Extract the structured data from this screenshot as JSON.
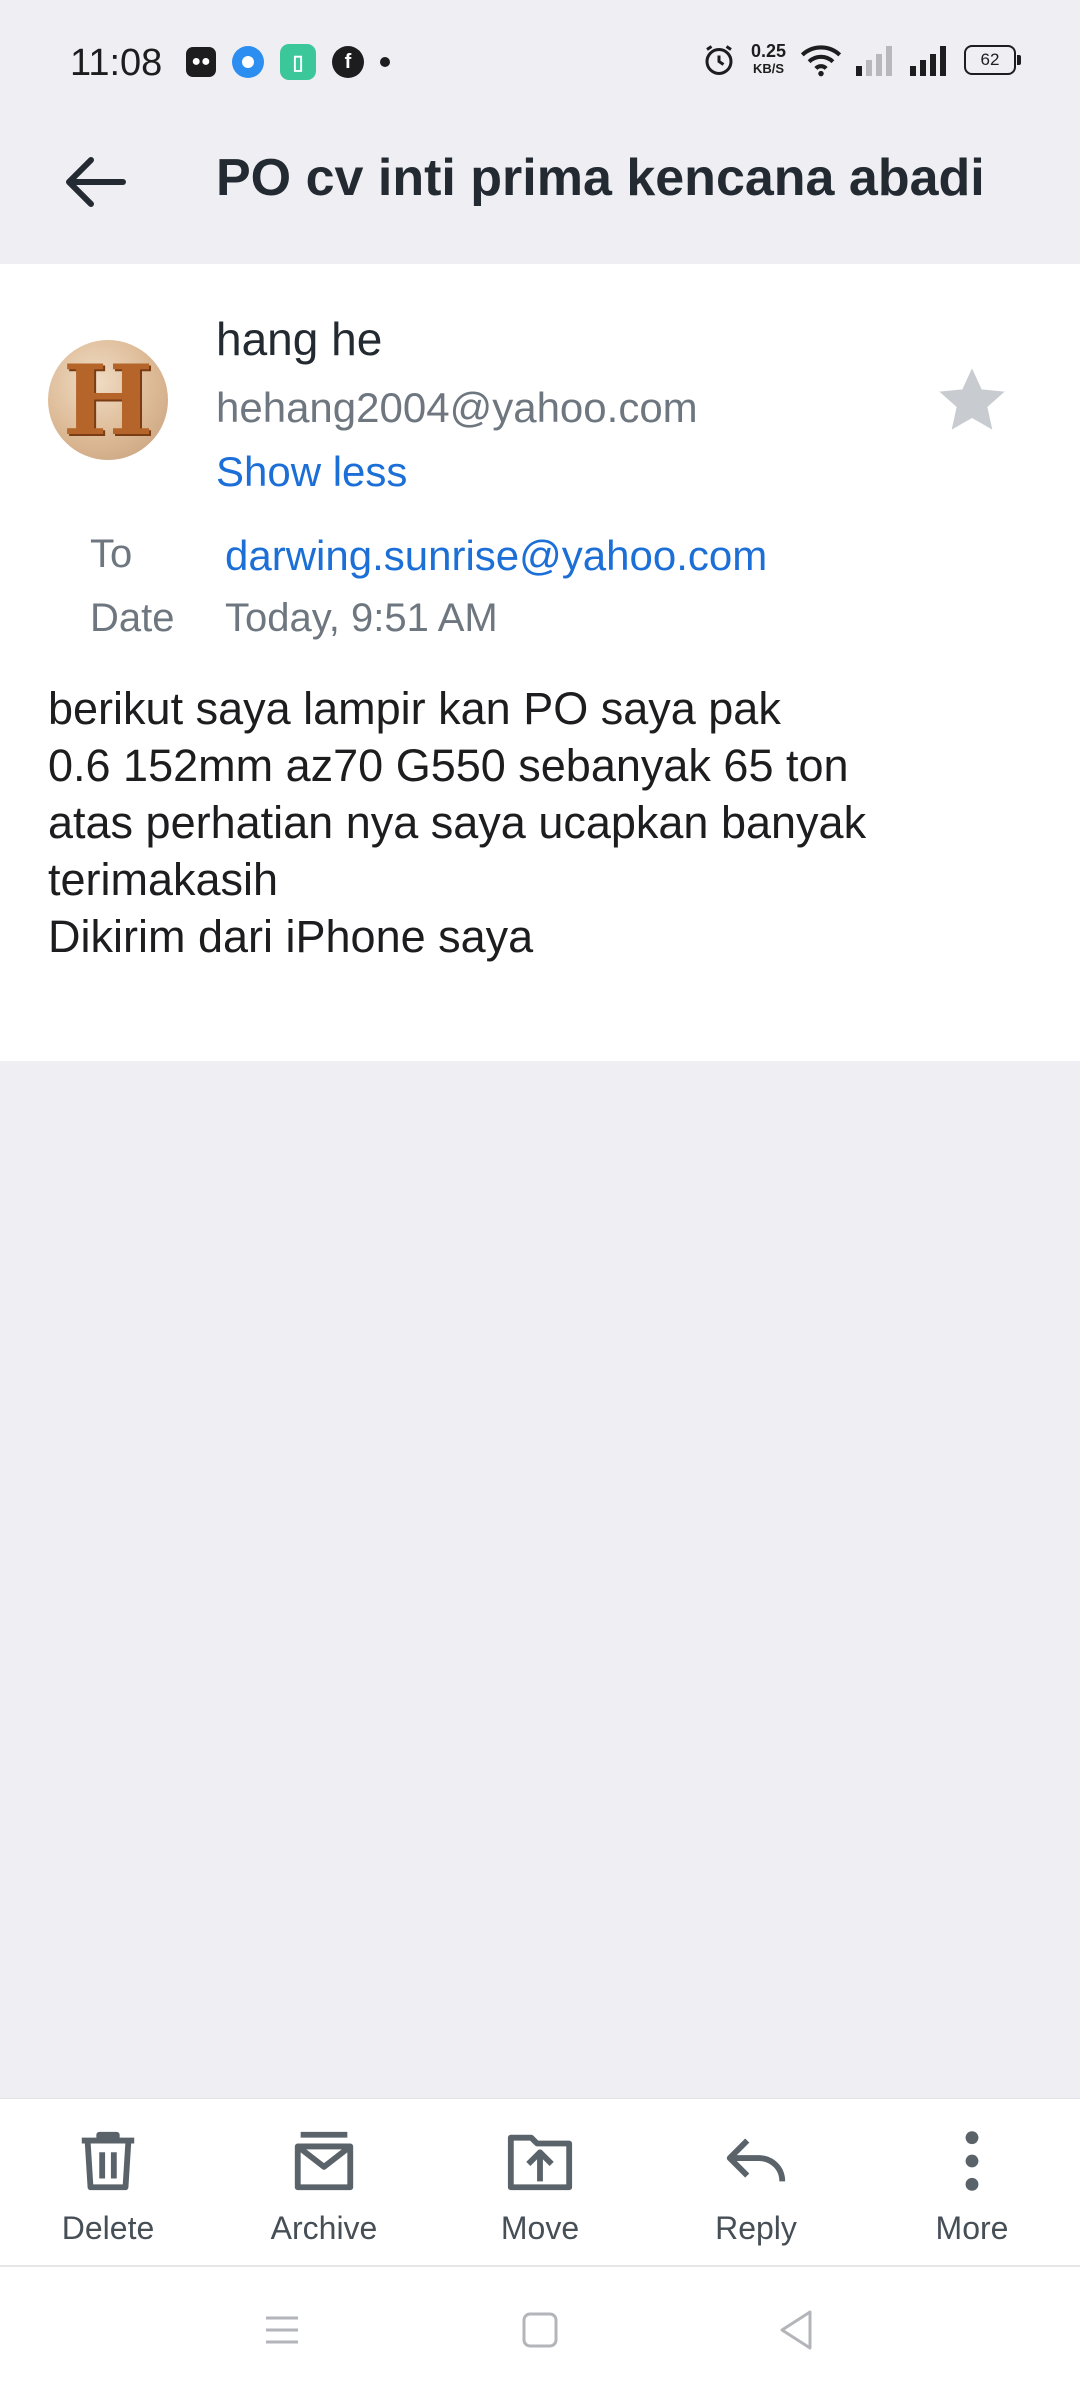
{
  "status_bar": {
    "time": "11:08",
    "net_speed_value": "0.25",
    "net_speed_unit": "KB/S",
    "battery": "62"
  },
  "header": {
    "title": "PO cv inti prima kencana abadi"
  },
  "email": {
    "avatar_letter": "H",
    "sender_name": "hang he",
    "sender_email": "hehang2004@yahoo.com",
    "toggle_label": "Show less",
    "to_label": "To",
    "to_value": "darwing.sunrise@yahoo.com",
    "date_label": "Date",
    "date_value": "Today, 9:51 AM",
    "body_lines": [
      "berikut saya lampir kan PO saya pak",
      "0.6 152mm az70 G550 sebanyak 65 ton",
      "",
      "atas perhatian nya saya ucapkan banyak",
      "terimakasih",
      "Dikirim dari iPhone saya"
    ]
  },
  "toolbar": {
    "delete": "Delete",
    "archive": "Archive",
    "move": "Move",
    "reply": "Reply",
    "more": "More"
  },
  "colors": {
    "link": "#1b6fd6",
    "background": "#efeff3",
    "card": "#ffffff"
  }
}
